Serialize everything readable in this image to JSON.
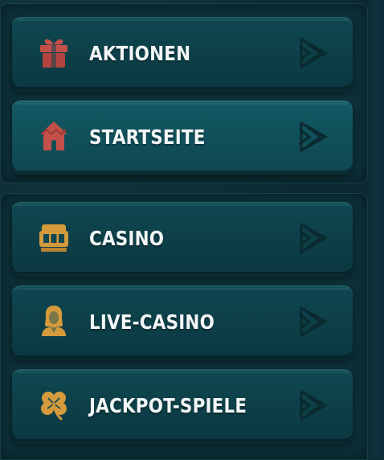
{
  "colors": {
    "background": "#0b2a33",
    "panel": "#0d3039",
    "button": "#0f4751",
    "button_active": "#125963",
    "label": "#f3f6f6",
    "icon_red": "#c4504a",
    "icon_gold": "#d49a3c",
    "arrow": "#0a2a30"
  },
  "menu": {
    "items": [
      {
        "label": "AKTIONEN",
        "icon": "gift-icon",
        "active": false
      },
      {
        "label": "STARTSEITE",
        "icon": "hut-icon",
        "active": true
      },
      {
        "label": "CASINO",
        "icon": "slot-machine-icon",
        "active": false
      },
      {
        "label": "LIVE-CASINO",
        "icon": "dealer-icon",
        "active": false
      },
      {
        "label": "JACKPOT-SPIELE",
        "icon": "clover-icon",
        "active": false
      }
    ]
  }
}
